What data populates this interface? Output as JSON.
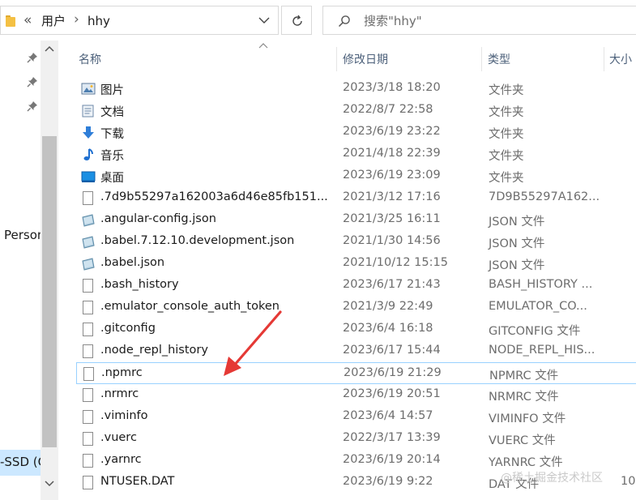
{
  "address": {
    "crumbs": [
      "用户",
      "hhy"
    ],
    "overflow": "«"
  },
  "search": {
    "placeholder": "搜索\"hhy\""
  },
  "nav": {
    "item_person": "Person",
    "item_ssd": "-SSD (C"
  },
  "columns": {
    "name": "名称",
    "date": "修改日期",
    "type": "类型",
    "size": "大小"
  },
  "files": [
    {
      "name": "图片",
      "date": "2023/3/18 18:20",
      "type": "文件夹",
      "size": "",
      "icon": "pictures-folder-icon"
    },
    {
      "name": "文档",
      "date": "2022/8/7 22:58",
      "type": "文件夹",
      "size": "",
      "icon": "documents-folder-icon"
    },
    {
      "name": "下载",
      "date": "2023/6/19 23:22",
      "type": "文件夹",
      "size": "",
      "icon": "downloads-folder-icon"
    },
    {
      "name": "音乐",
      "date": "2021/4/18 22:39",
      "type": "文件夹",
      "size": "",
      "icon": "music-folder-icon"
    },
    {
      "name": "桌面",
      "date": "2023/6/19 23:09",
      "type": "文件夹",
      "size": "",
      "icon": "desktop-folder-icon"
    },
    {
      "name": ".7d9b55297a162003a6d46e85fb151...",
      "date": "2021/3/12 17:16",
      "type": "7D9B55297A162...",
      "size": "",
      "icon": "file-icon"
    },
    {
      "name": ".angular-config.json",
      "date": "2021/3/25 16:11",
      "type": "JSON 文件",
      "size": "",
      "icon": "json-file-icon"
    },
    {
      "name": ".babel.7.12.10.development.json",
      "date": "2021/1/30 14:56",
      "type": "JSON 文件",
      "size": "",
      "icon": "json-file-icon"
    },
    {
      "name": ".babel.json",
      "date": "2021/10/12 15:15",
      "type": "JSON 文件",
      "size": "",
      "icon": "json-file-icon"
    },
    {
      "name": ".bash_history",
      "date": "2023/6/17 21:43",
      "type": "BASH_HISTORY ...",
      "size": "",
      "icon": "file-icon"
    },
    {
      "name": ".emulator_console_auth_token",
      "date": "2021/3/9 22:49",
      "type": "EMULATOR_CO...",
      "size": "",
      "icon": "file-icon"
    },
    {
      "name": ".gitconfig",
      "date": "2023/6/4 16:18",
      "type": "GITCONFIG 文件",
      "size": "",
      "icon": "file-icon"
    },
    {
      "name": ".node_repl_history",
      "date": "2023/6/17 15:44",
      "type": "NODE_REPL_HIS...",
      "size": "",
      "icon": "file-icon"
    },
    {
      "name": ".npmrc",
      "date": "2023/6/19 21:29",
      "type": "NPMRC 文件",
      "size": "",
      "icon": "file-icon",
      "selected": true
    },
    {
      "name": ".nrmrc",
      "date": "2023/6/19 20:51",
      "type": "NRMRC 文件",
      "size": "",
      "icon": "file-icon"
    },
    {
      "name": ".viminfo",
      "date": "2023/6/4 14:57",
      "type": "VIMINFO 文件",
      "size": "",
      "icon": "file-icon"
    },
    {
      "name": ".vuerc",
      "date": "2022/3/17 13:39",
      "type": "VUERC 文件",
      "size": "",
      "icon": "file-icon"
    },
    {
      "name": ".yarnrc",
      "date": "2023/6/19 20:14",
      "type": "YARNRC 文件",
      "size": "",
      "icon": "file-icon"
    },
    {
      "name": "NTUSER.DAT",
      "date": "2023/6/19 9:22",
      "type": "DAT 文件",
      "size": "10,",
      "icon": "file-icon"
    }
  ],
  "watermark": "@稀土掘金技术社区",
  "colors": {
    "selection_border": "#99d1ff",
    "selection_fill": "#cce8ff",
    "annotation_arrow": "#e53935"
  }
}
